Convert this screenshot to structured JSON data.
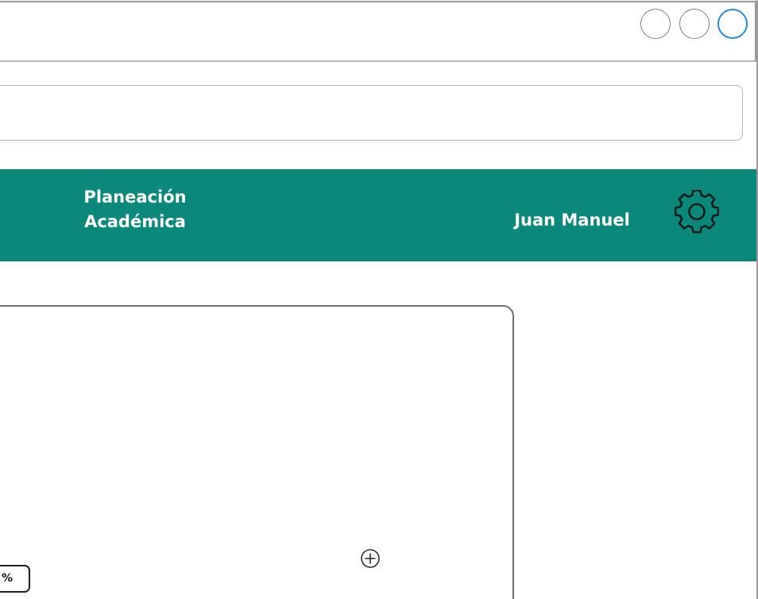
{
  "window": {
    "controls": [
      "window-button",
      "window-button",
      "window-button-active"
    ]
  },
  "navbar": {
    "title_line1": "Planeación",
    "title_line2": "Académica",
    "user_name": "Juan Manuel",
    "settings_icon": "gear-icon",
    "background": "#0a887b",
    "text_color": "#ffffff"
  },
  "content": {
    "percent_label": "%",
    "add_icon": "plus-circle-icon"
  },
  "colors": {
    "accent": "#1e88e5",
    "brand": "#0a887b"
  }
}
